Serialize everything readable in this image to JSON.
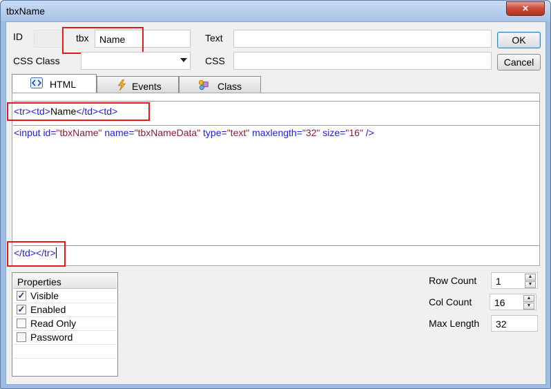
{
  "window": {
    "title": "tbxName",
    "close_icon": "×"
  },
  "form": {
    "id_label": "ID",
    "id_prefix": "tbx",
    "id_value": "Name",
    "text_label": "Text",
    "text_value": "",
    "css_class_label": "CSS Class",
    "css_class_value": "",
    "css_label": "CSS",
    "css_value": "",
    "ok_label": "OK",
    "cancel_label": "Cancel"
  },
  "tabs": [
    {
      "label": "HTML",
      "icon": "html-code-icon",
      "active": true
    },
    {
      "label": "Events",
      "icon": "lightning-icon",
      "active": false
    },
    {
      "label": "Class",
      "icon": "class-icon",
      "active": false
    }
  ],
  "code": {
    "prefix": {
      "tag_tr_open": "<tr>",
      "tag_td_open1": "<td>",
      "text": "Name",
      "tag_td_close": "</td>",
      "tag_td_open2": "<td>"
    },
    "body": {
      "tag_open": "<input",
      "attrs": [
        {
          "name": "id",
          "value": "\"tbxName\""
        },
        {
          "name": "name",
          "value": "\"tbxNameData\""
        },
        {
          "name": "type",
          "value": "\"text\""
        },
        {
          "name": "maxlength",
          "value": "\"32\""
        },
        {
          "name": "size",
          "value": "\"16\""
        }
      ],
      "tag_close": "/>"
    },
    "suffix": {
      "tag_td_close": "</td>",
      "tag_tr_close": "</tr>"
    }
  },
  "properties": {
    "header": "Properties",
    "items": [
      {
        "label": "Visible",
        "checked": true
      },
      {
        "label": "Enabled",
        "checked": true
      },
      {
        "label": "Read Only",
        "checked": false
      },
      {
        "label": "Password",
        "checked": false
      }
    ]
  },
  "settings": {
    "row_count_label": "Row Count",
    "row_count_value": "1",
    "col_count_label": "Col Count",
    "col_count_value": "16",
    "max_length_label": "Max Length",
    "max_length_value": "32"
  },
  "colors": {
    "highlight_box": "#e21a1a",
    "tag_color": "#1c1ce0",
    "value_color": "#8b1a3d"
  }
}
